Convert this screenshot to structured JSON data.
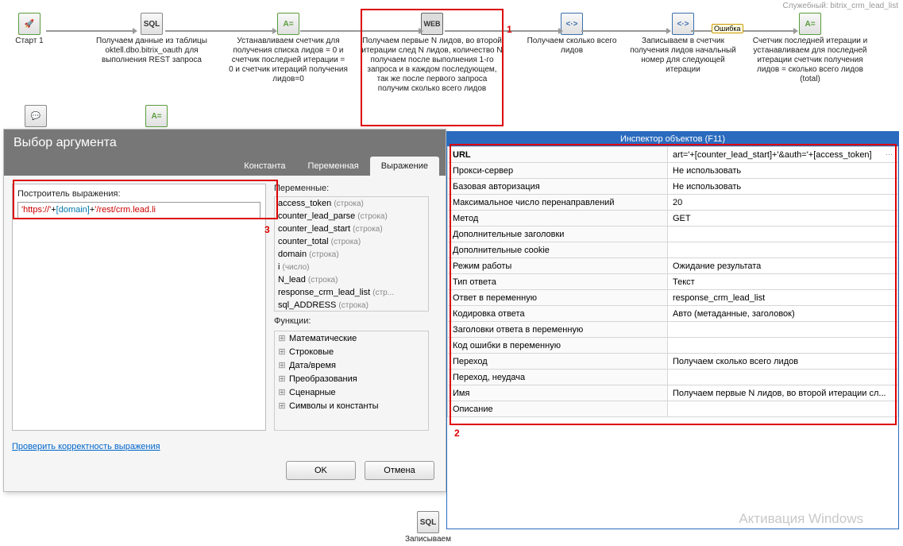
{
  "service_tag": "Служебный: bitrix_crm_lead_list",
  "flow": {
    "n0": {
      "icon": "🚀",
      "label": "Старт 1"
    },
    "n1": {
      "icon": "SQL",
      "label": "Получаем данные из таблицы oktell.dbo.bitrix_oauth для выполнения REST запроса"
    },
    "n2": {
      "icon": "A=",
      "label": "Устанавливаем счетчик для получения списка лидов = 0 и счетчик последней итерации = 0 и счетчик итераций получения лидов=0"
    },
    "n3": {
      "icon": "WEB",
      "label": "Получаем первые N лидов, во второй итерации след N лидов, количество N получаем после выполнения 1-го запроса и в каждом последующем, так же после первого запроса получим сколько всего лидов"
    },
    "n4": {
      "icon": "<·>",
      "label": "Получаем сколько всего лидов"
    },
    "n5": {
      "icon": "<·>",
      "label": "Записываем в счетчик получения лидов начальный номер для следующей итерации"
    },
    "n6": {
      "icon": "A=",
      "label": "Счетчик последней итерации и устанавливаем для последней итерации счетчик получения лидов = сколько всего лидов (total)"
    },
    "r2a": {
      "icon": "💬"
    },
    "r2b": {
      "icon": "A="
    },
    "bottom": {
      "icon": "SQL",
      "label": "Записываем"
    },
    "err": "Ошибка"
  },
  "annot": {
    "a1": "1",
    "a2": "2",
    "a3": "3"
  },
  "dialog": {
    "title": "Выбор аргумента",
    "tabs": [
      "Константа",
      "Переменная",
      "Выражение"
    ],
    "active_tab": 2,
    "builder_label": "Построитель выражения:",
    "expr_parts": [
      "'https://'",
      "+",
      "[domain]",
      "+",
      "'/rest/crm.lead.li"
    ],
    "vars_label": "Переменные:",
    "vars": [
      {
        "n": "access_token",
        "t": "(строка)"
      },
      {
        "n": "counter_lead_parse",
        "t": "(строка)"
      },
      {
        "n": "counter_lead_start",
        "t": "(строка)"
      },
      {
        "n": "counter_total",
        "t": "(строка)"
      },
      {
        "n": "domain",
        "t": "(строка)"
      },
      {
        "n": "i",
        "t": "(число)"
      },
      {
        "n": "N_lead",
        "t": "(строка)"
      },
      {
        "n": "response_crm_lead_list",
        "t": "(стр..."
      },
      {
        "n": "sql_ADDRESS",
        "t": "(строка)"
      }
    ],
    "funcs_label": "Функции:",
    "funcs": [
      "Математические",
      "Строковые",
      "Дата/время",
      "Преобразования",
      "Сценарные",
      "Символы и константы"
    ],
    "check": "Проверить корректность выражения",
    "ok": "OK",
    "cancel": "Отмена"
  },
  "inspector": {
    "title": "Инспектор объектов (F11)",
    "rows": [
      {
        "k": "URL",
        "v": "art='+[counter_lead_start]+'&auth='+[access_token]",
        "b": true,
        "dd": true
      },
      {
        "k": "Прокси-сервер",
        "v": "Не использовать"
      },
      {
        "k": "Базовая авторизация",
        "v": "Не использовать"
      },
      {
        "k": "Максимальное число перенаправлений",
        "v": "20"
      },
      {
        "k": "Метод",
        "v": "GET"
      },
      {
        "k": "Дополнительные заголовки",
        "v": ""
      },
      {
        "k": "Дополнительные cookie",
        "v": ""
      },
      {
        "k": "Режим работы",
        "v": "Ожидание результата"
      },
      {
        "k": "Тип ответа",
        "v": "Текст"
      },
      {
        "k": "Ответ в переменную",
        "v": "response_crm_lead_list"
      },
      {
        "k": "Кодировка ответа",
        "v": "Авто (метаданные, заголовок)"
      },
      {
        "k": "Заголовки ответа в переменную",
        "v": ""
      },
      {
        "k": "Код ошибки в переменную",
        "v": ""
      },
      {
        "k": "Переход",
        "v": "Получаем сколько всего лидов"
      },
      {
        "k": "Переход, неудача",
        "v": ""
      },
      {
        "k": "Имя",
        "v": "Получаем первые N лидов, во второй итерации сл..."
      },
      {
        "k": "Описание",
        "v": ""
      }
    ]
  },
  "watermark": "Активация Windows"
}
